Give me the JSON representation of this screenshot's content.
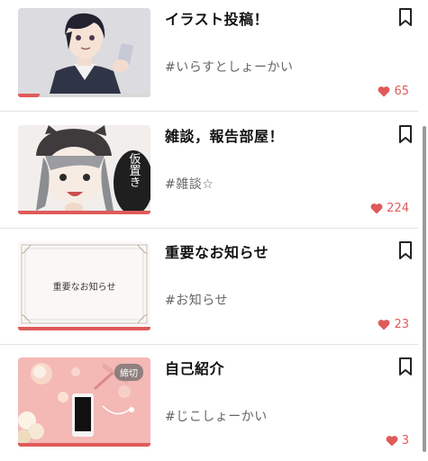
{
  "colors": {
    "accent": "#e05a5a",
    "divider": "#e2e2e2",
    "tag_text": "#666666"
  },
  "posts": [
    {
      "title": "イラスト投稿！",
      "tag": "#いらすとしょーかい",
      "likes": "65",
      "progress": 0.16,
      "badge": "",
      "thumbnail": "anime-boy-with-phone"
    },
    {
      "title": "雑談，報告部屋！",
      "tag": "#雑談☆",
      "likes": "224",
      "progress": 1.0,
      "badge": "",
      "thumbnail": "anime-character-with-beanie",
      "thumbnail_text": "仮置き"
    },
    {
      "title": "重要なお知らせ",
      "tag": "#お知らせ",
      "likes": "23",
      "progress": 1.0,
      "badge": "",
      "thumbnail": "notice-card",
      "thumbnail_text": "重要なお知らせ"
    },
    {
      "title": "自己紹介",
      "tag": "#じこしょーかい",
      "likes": "3",
      "progress": 1.0,
      "badge": "締切",
      "thumbnail": "pink-desk-with-phone"
    }
  ],
  "icons": {
    "bookmark": "bookmark-icon",
    "like": "heart-icon"
  }
}
